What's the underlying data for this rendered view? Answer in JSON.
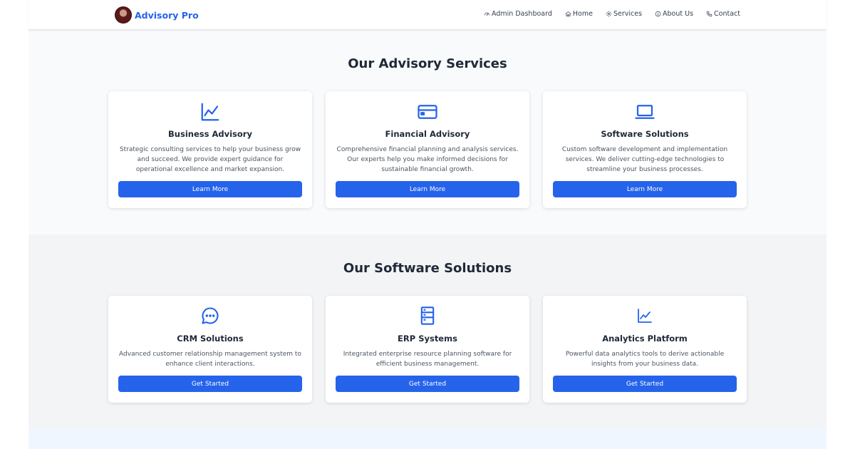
{
  "header": {
    "brand": "Advisory Pro",
    "nav": [
      {
        "label": "Admin Dashboard",
        "icon": "dashboard-icon"
      },
      {
        "label": "Home",
        "icon": "home-icon"
      },
      {
        "label": "Services",
        "icon": "gear-icon"
      },
      {
        "label": "About Us",
        "icon": "info-icon"
      },
      {
        "label": "Contact",
        "icon": "phone-icon"
      }
    ]
  },
  "services": {
    "title": "Our Advisory Services",
    "cards": [
      {
        "title": "Business Advisory",
        "icon": "chart-line-icon",
        "description": "Strategic consulting services to help your business grow and succeed. We provide expert guidance for operational excellence and market expansion.",
        "button": "Learn More"
      },
      {
        "title": "Financial Advisory",
        "icon": "credit-card-icon",
        "description": "Comprehensive financial planning and analysis services. Our experts help you make informed decisions for sustainable financial growth.",
        "button": "Learn More"
      },
      {
        "title": "Software Solutions",
        "icon": "laptop-icon",
        "description": "Custom software development and implementation services. We deliver cutting-edge technologies to streamline your business processes.",
        "button": "Learn More"
      }
    ]
  },
  "software": {
    "title": "Our Software Solutions",
    "cards": [
      {
        "title": "CRM Solutions",
        "icon": "chat-icon",
        "description": "Advanced customer relationship management system to enhance client interactions.",
        "button": "Get Started"
      },
      {
        "title": "ERP Systems",
        "icon": "server-icon",
        "description": "Integrated enterprise resource planning software for efficient business management.",
        "button": "Get Started"
      },
      {
        "title": "Analytics Platform",
        "icon": "analytics-icon",
        "description": "Powerful data analytics tools to derive actionable insights from your business data.",
        "button": "Get Started"
      }
    ]
  },
  "colors": {
    "accent": "#2563eb",
    "text": "#1f2937",
    "services_bg": "#f8fafc",
    "software_bg": "#f3f4f6",
    "footer_band_bg": "#eff6ff"
  }
}
